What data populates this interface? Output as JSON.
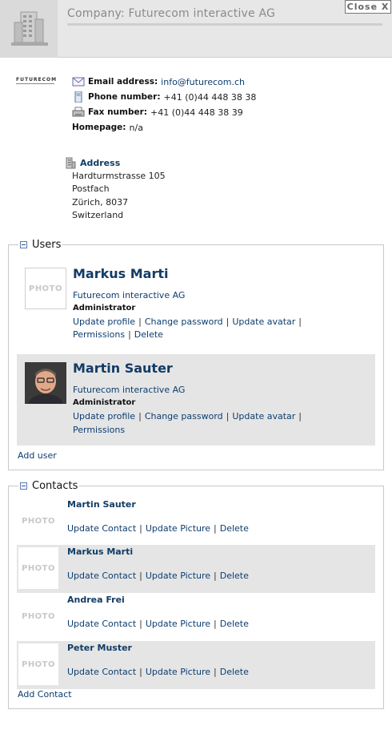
{
  "header": {
    "title": "Company: Futurecom interactive AG",
    "close_label": "Close X",
    "icon": "building-icon"
  },
  "company": {
    "logo_text": "FUTURECOM",
    "email": {
      "label": "Email address:",
      "value": "info@futurecom.ch",
      "icon": "email-icon"
    },
    "phone": {
      "label": "Phone number:",
      "value": "+41 (0)44 448 38 38",
      "icon": "phone-icon"
    },
    "fax": {
      "label": "Fax number:",
      "value": "+41 (0)44 448 38 39",
      "icon": "fax-icon"
    },
    "homepage": {
      "label": "Homepage:",
      "value": "n/a"
    },
    "address": {
      "heading": "Address",
      "icon": "address-building-icon",
      "lines": [
        "Hardturmstrasse 105",
        "Postfach",
        "Zürich, 8037",
        "Switzerland"
      ]
    }
  },
  "users": {
    "legend": "Users",
    "add_label": "Add user",
    "items": [
      {
        "name": "Markus Marti",
        "company": "Futurecom interactive AG",
        "role": "Administrator",
        "photo_placeholder": "PHOTO",
        "links": [
          "Update profile",
          "Change password",
          "Update avatar",
          "Permissions",
          "Delete"
        ]
      },
      {
        "name": "Martin Sauter",
        "company": "Futurecom interactive AG",
        "role": "Administrator",
        "links": [
          "Update profile",
          "Change password",
          "Update avatar",
          "Permissions"
        ]
      }
    ]
  },
  "contacts": {
    "legend": "Contacts",
    "add_label": "Add Contact",
    "action_labels": [
      "Update Contact",
      "Update Picture",
      "Delete"
    ],
    "photo_placeholder": "PHOTO",
    "items": [
      {
        "name": "Martin Sauter"
      },
      {
        "name": "Markus Marti"
      },
      {
        "name": "Andrea Frei"
      },
      {
        "name": "Peter Muster"
      }
    ]
  },
  "colors": {
    "link": "#0d3d6f",
    "header_bg": "#e7e7e7",
    "row_shade": "#e5e5e5"
  }
}
